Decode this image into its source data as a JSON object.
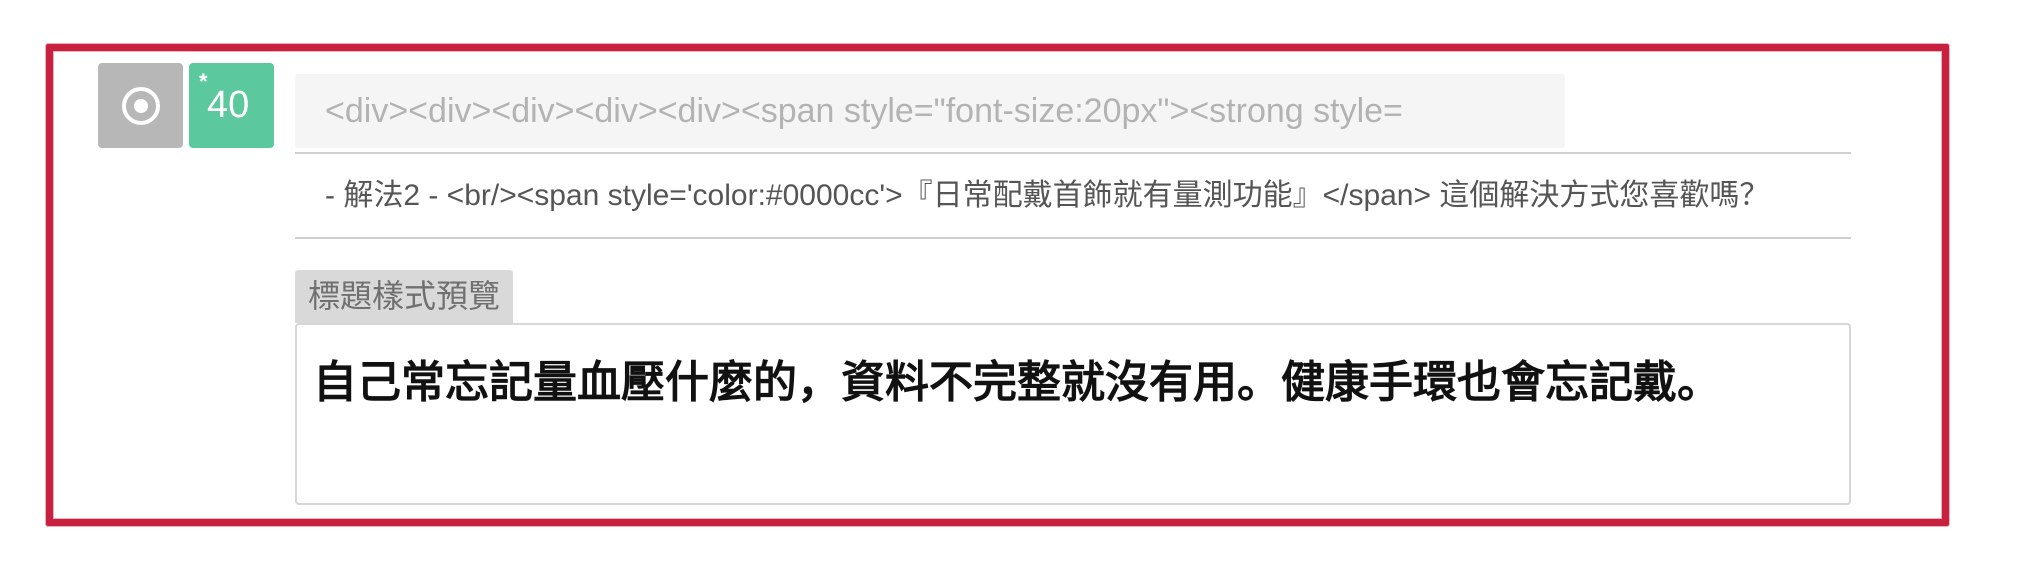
{
  "toolbar": {
    "toggle_icon": "radio-selected-icon",
    "badge_star": "*",
    "badge_count": "40"
  },
  "editor": {
    "html_source": "<div><div><div><div><div><span style=\"font-size:20px\"><strong style=",
    "subtitle_source": "- 解法2 - <br/><span style='color:#0000cc'>『日常配戴首飾就有量測功能』</span> 這個解決方式您喜歡嗎？"
  },
  "preview": {
    "label": "標題樣式預覽",
    "text": "自己常忘記量血壓什麼的，資料不完整就沒有用。健康手環也會忘記戴。"
  },
  "colors": {
    "frame": "#c8213f",
    "badge_green": "#5bc89e",
    "toggle_gray": "#b7b7b7",
    "preview_label_bg": "#d9d9d9"
  }
}
